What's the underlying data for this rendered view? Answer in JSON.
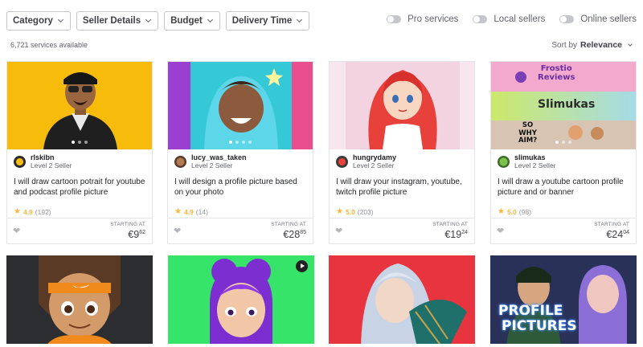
{
  "filters": [
    {
      "label": "Category"
    },
    {
      "label": "Seller Details"
    },
    {
      "label": "Budget"
    },
    {
      "label": "Delivery Time"
    }
  ],
  "toggles": [
    {
      "label": "Pro services"
    },
    {
      "label": "Local sellers"
    },
    {
      "label": "Online sellers"
    }
  ],
  "results_count": "6,721 services available",
  "sort": {
    "label": "Sort by",
    "value": "Relevance"
  },
  "cards": [
    {
      "seller": "rlskibn",
      "level": "Level 2 Seller",
      "title": "I will draw cartoon potrait for youtube and podcast profile picture",
      "rating": "4.9",
      "reviews": "(192)",
      "starting_at": "STARTING AT",
      "price_main": "€9",
      "price_cents": "62"
    },
    {
      "seller": "lucy_was_taken",
      "level": "Level 2 Seller",
      "title": "I will design a profile picture based on your photo",
      "rating": "4.9",
      "reviews": "(14)",
      "starting_at": "STARTING AT",
      "price_main": "€28",
      "price_cents": "85"
    },
    {
      "seller": "hungrydamy",
      "level": "Level 2 Seller",
      "title": "I will draw your instagram, youtube, twitch profile picture",
      "rating": "5.0",
      "reviews": "(203)",
      "starting_at": "STARTING AT",
      "price_main": "€19",
      "price_cents": "24"
    },
    {
      "seller": "slimukas",
      "level": "Level 2 Seller",
      "title": "I will draw a youtube cartoon profile picture and or banner",
      "rating": "5.0",
      "reviews": "(98)",
      "starting_at": "STARTING AT",
      "price_main": "€24",
      "price_cents": "04"
    }
  ],
  "thumb4_text": {
    "line1": "Frostio",
    "line2": "Reviews",
    "line3": "Slimukas",
    "line4": "SO",
    "line5": "WHY",
    "line6": "AIM?"
  },
  "row2_thumb4_text": {
    "line1": "PROFILE",
    "line2": "PICTURES"
  },
  "colors": {
    "star": "#ffb33e",
    "border": "#e4e5e7"
  }
}
